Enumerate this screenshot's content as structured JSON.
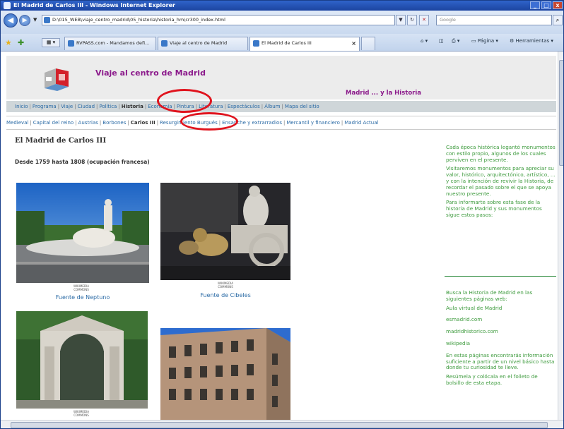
{
  "window": {
    "title": "El Madrid de Carlos III - Windows Internet Explorer",
    "min": "_",
    "max": "□",
    "close": "x"
  },
  "address": {
    "url": "D:\\015_WEB\\viaje_centro_madrid\\05_historia\\historia_hm\\cr300_index.html",
    "search_placeholder": "Google"
  },
  "tabs": [
    {
      "label": "RVPASS.com - Mandamos defi..."
    },
    {
      "label": "Viaje al centro de Madrid"
    },
    {
      "label": "El Madrid de Carlos III"
    }
  ],
  "commands": {
    "page": "Página",
    "tools": "Herramientas"
  },
  "site": {
    "title": "Viaje al centro de Madrid",
    "subtitle": "Madrid ... y la Historia"
  },
  "menu_main": [
    {
      "label": "Inicio",
      "selected": false
    },
    {
      "label": "Programa",
      "selected": false
    },
    {
      "label": "Viaje",
      "selected": false
    },
    {
      "label": "Ciudad",
      "selected": false
    },
    {
      "label": "Política",
      "selected": false
    },
    {
      "label": "Historia",
      "selected": true
    },
    {
      "label": "Economía",
      "selected": false
    },
    {
      "label": "Pintura",
      "selected": false
    },
    {
      "label": "Literatura",
      "selected": false
    },
    {
      "label": "Espectáculos",
      "selected": false
    },
    {
      "label": "Álbum",
      "selected": false
    },
    {
      "label": "Mapa del sitio",
      "selected": false
    }
  ],
  "menu_history": [
    {
      "label": "Medieval",
      "selected": false
    },
    {
      "label": "Capital del reino",
      "selected": false
    },
    {
      "label": "Austrias",
      "selected": false
    },
    {
      "label": "Borbones",
      "selected": false
    },
    {
      "label": "Carlos III",
      "selected": true
    },
    {
      "label": "Resurgimiento Burgués",
      "selected": false
    },
    {
      "label": "Ensanche y extrarradios",
      "selected": false
    },
    {
      "label": "Mercantil y financiero",
      "selected": false
    },
    {
      "label": "Madrid Actual",
      "selected": false
    }
  ],
  "content": {
    "heading": "El Madrid de Carlos III",
    "period": "Desde 1759 hasta 1808 (ocupación francesa)",
    "photos": [
      {
        "caption": "Fuente de Neptuno",
        "credit": "WIKIMEDIA COMMONS"
      },
      {
        "caption": "Fuente de Cibeles",
        "credit": "WIKIMEDIA COMMONS"
      },
      {
        "caption": "",
        "credit": "WIKIMEDIA COMMONS"
      },
      {
        "caption": "",
        "credit": ""
      }
    ]
  },
  "sidebar": {
    "intro": [
      "Cada época histórica legantó monumentos con estilo propio, algunos de los cuales perviven en el presente.",
      "Visitaremos monumentos para apreciar su valor, histórico, arquitectónico, artístico, ... y con la intención de revivir la Historia, de recordar el pasado sobre el que se apoya nuestro presente.",
      "Para informarte sobre esta fase de la historia de Madrid y sus monumentos sigue estos pasos:"
    ],
    "search_intro": "Busca la Historia de Madrid en las siguientes páginas web:",
    "links": [
      "Aula virtual de Madrid",
      "esmadrid.com",
      "madridhistorico.com",
      "wikipedia"
    ],
    "outro": [
      "En estas páginas encontrarás información suficiente a partir de un nivel básico hasta donde tu curiosidad te lleve.",
      "Resúmela y colócala en el folleto de bolsillo de esta etapa."
    ]
  }
}
